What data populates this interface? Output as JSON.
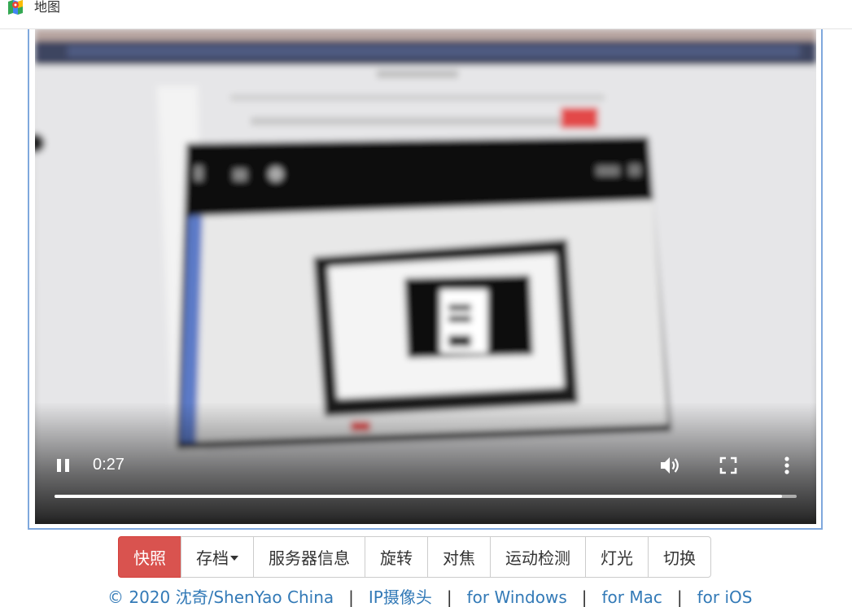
{
  "header": {
    "title": "地图",
    "icon": "maps-icon"
  },
  "video": {
    "time": "0:27",
    "progress_fraction": 0.98,
    "controls": {
      "play_state_icon": "pause-icon",
      "volume_icon": "volume-icon",
      "fullscreen_icon": "fullscreen-icon",
      "more_icon": "more-vert-icon"
    }
  },
  "toolbar": {
    "buttons": [
      {
        "label": "快照",
        "style": "danger"
      },
      {
        "label": "存档",
        "style": "dropdown"
      },
      {
        "label": "服务器信息"
      },
      {
        "label": "旋转"
      },
      {
        "label": "对焦"
      },
      {
        "label": "运动检测"
      },
      {
        "label": "灯光"
      },
      {
        "label": "切换"
      }
    ]
  },
  "footer": {
    "copyright": "© 2020 沈奇/ShenYao China",
    "links": [
      "IP摄像头",
      "for Windows",
      "for Mac",
      "for iOS"
    ],
    "separator": "|"
  },
  "colors": {
    "danger": "#d9534f",
    "link": "#337ab7",
    "frame_border": "#7fa8dd"
  }
}
